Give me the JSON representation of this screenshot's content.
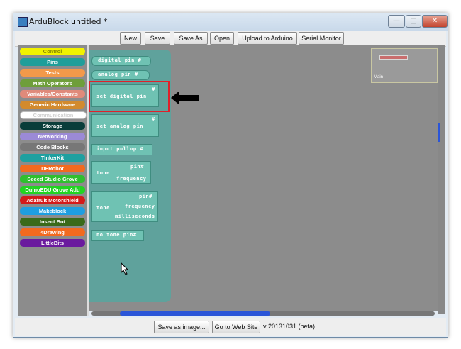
{
  "window": {
    "title": "ArduBlock untitled *"
  },
  "window_controls": {
    "minimize": "—",
    "maximize": "□",
    "close": "✕"
  },
  "toolbar": {
    "new": "New",
    "save": "Save",
    "save_as": "Save As",
    "open": "Open",
    "upload": "Upload to Arduino",
    "serial": "Serial Monitor"
  },
  "categories": [
    {
      "label": "Control",
      "color": "#f2f200"
    },
    {
      "label": "Pins",
      "color": "#1f9e9a"
    },
    {
      "label": "Tests",
      "color": "#f2994a"
    },
    {
      "label": "Math Operators",
      "color": "#6e9e3a"
    },
    {
      "label": "Variables/Constants",
      "color": "#e08a7a"
    },
    {
      "label": "Generic Hardware",
      "color": "#d28a2e"
    },
    {
      "label": "Communication",
      "color": "#ffffff"
    },
    {
      "label": "Storage",
      "color": "#0a3d3a"
    },
    {
      "label": "Networking",
      "color": "#9b8ad6"
    },
    {
      "label": "Code Blocks",
      "color": "#777777"
    },
    {
      "label": "TinkerKit",
      "color": "#1ea0a0"
    },
    {
      "label": "DFRobot",
      "color": "#f26a1f"
    },
    {
      "label": "Seeed Studio Grove",
      "color": "#2fbf2f"
    },
    {
      "label": "DuinoEDU Grove Add",
      "color": "#22d422"
    },
    {
      "label": "Adafruit Motorshield",
      "color": "#d41a1a"
    },
    {
      "label": "Makeblock",
      "color": "#1e9ee0"
    },
    {
      "label": "Insect Bot",
      "color": "#3a6a1a"
    },
    {
      "label": "4Drawing",
      "color": "#f26a1f"
    },
    {
      "label": "LittleBits",
      "color": "#6a1a9e"
    }
  ],
  "blocks": {
    "digital_pin": "digital pin #",
    "analog_pin": "analog pin #",
    "set_digital_pin": "set digital pin",
    "set_analog_pin": "set analog pin",
    "input_pullup": "input pullup #",
    "tone1_label": "tone",
    "tone1_pin": "pin#",
    "tone1_freq": "frequency",
    "tone2_label": "tone",
    "tone2_pin": "pin#",
    "tone2_freq": "frequency",
    "tone2_ms": "milliseconds",
    "no_tone": "no tone pin#",
    "hash": "#"
  },
  "minimap": {
    "label": "Main"
  },
  "status": {
    "save_image": "Save as image...",
    "website": "Go to Web Site",
    "version": "v 20131031 (beta)"
  },
  "colors": {
    "block_fill": "#6fc2b3",
    "drawer": "#5fa29c",
    "highlight": "#e0202a",
    "canvas": "#8c8c8c"
  }
}
